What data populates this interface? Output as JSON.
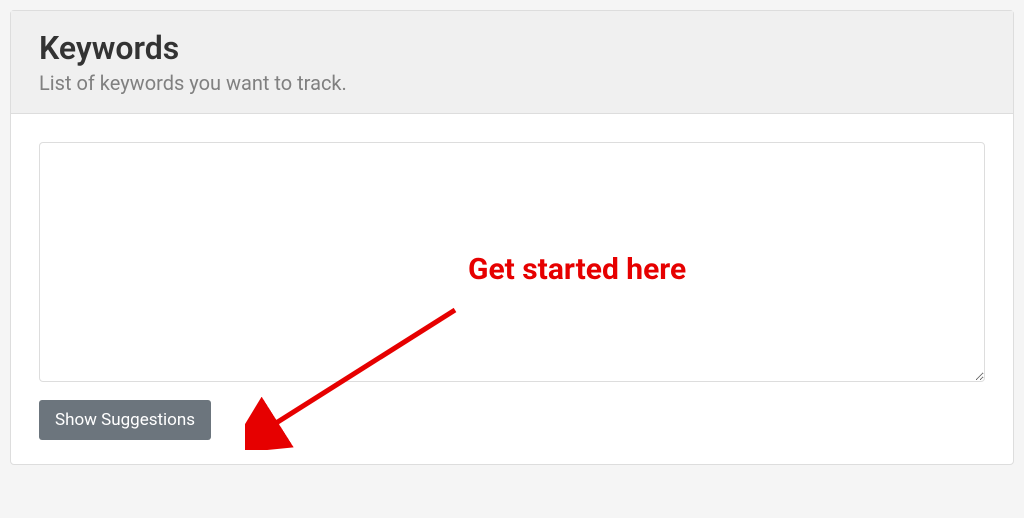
{
  "panel": {
    "title": "Keywords",
    "subtitle": "List of keywords you want to track."
  },
  "textarea": {
    "value": "",
    "placeholder": ""
  },
  "button": {
    "label": "Show Suggestions"
  },
  "annotation": {
    "text": "Get started here",
    "color": "#e60000"
  }
}
